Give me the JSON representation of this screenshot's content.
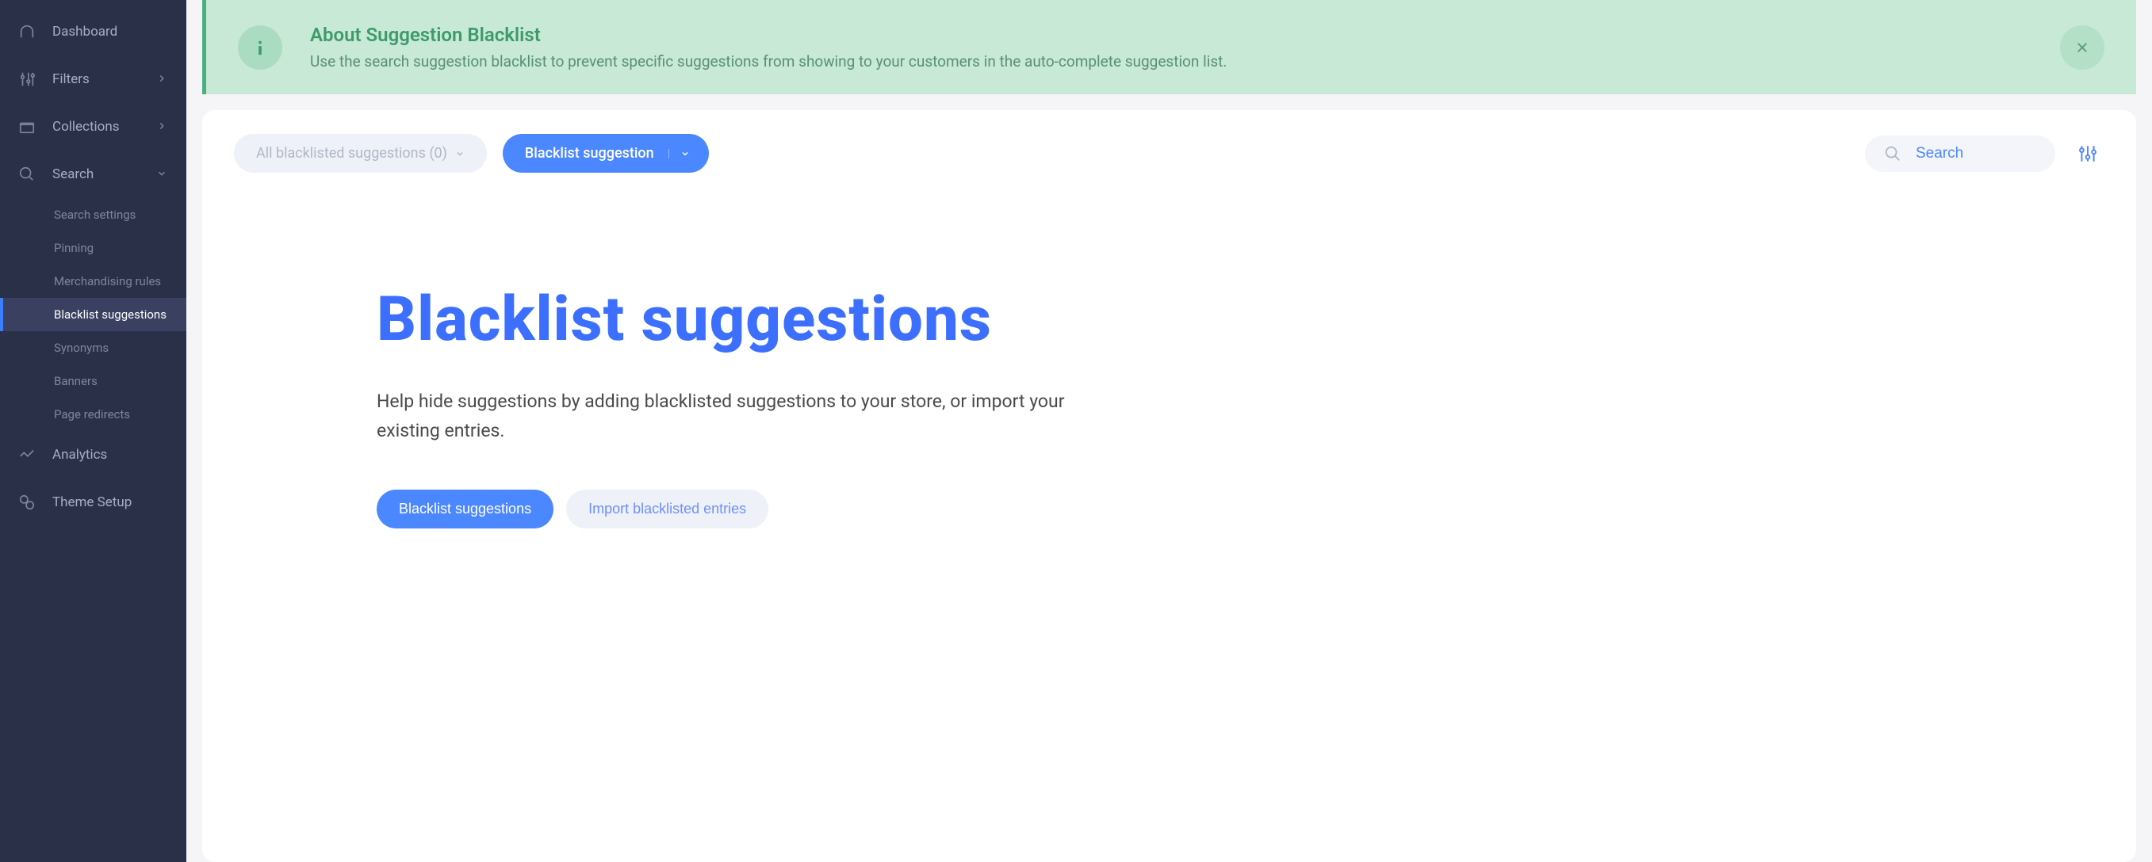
{
  "sidebar": {
    "items": [
      {
        "label": "Dashboard"
      },
      {
        "label": "Filters"
      },
      {
        "label": "Collections"
      },
      {
        "label": "Search"
      },
      {
        "label": "Analytics"
      },
      {
        "label": "Theme Setup"
      }
    ],
    "search_sub": [
      {
        "label": "Search settings"
      },
      {
        "label": "Pinning"
      },
      {
        "label": "Merchandising rules"
      },
      {
        "label": "Blacklist suggestions"
      },
      {
        "label": "Synonyms"
      },
      {
        "label": "Banners"
      },
      {
        "label": "Page redirects"
      }
    ]
  },
  "banner": {
    "title": "About Suggestion Blacklist",
    "desc": "Use the search suggestion blacklist to prevent specific suggestions from showing to your customers in the auto-complete suggestion list."
  },
  "toolbar": {
    "filter_label": "All blacklisted suggestions (0)",
    "action_label": "Blacklist suggestion",
    "search_placeholder": "Search"
  },
  "hero": {
    "title": "Blacklist suggestions",
    "desc": "Help hide suggestions by adding blacklisted suggestions to your store, or import your existing entries.",
    "primary_btn": "Blacklist suggestions",
    "secondary_btn": "Import blacklisted entries"
  }
}
